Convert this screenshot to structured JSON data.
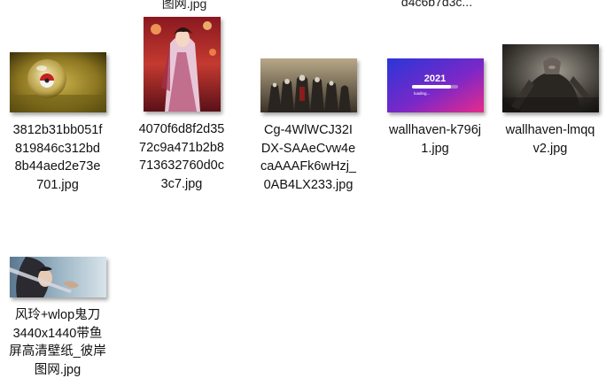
{
  "cutoff_labels": {
    "first": "图网.jpg",
    "second": "d4c6b7d3c..."
  },
  "files": [
    {
      "name_lines": [
        "3812b31bb051f",
        "819846c312bd",
        "8b44aed2e73e",
        "701.jpg"
      ],
      "thumb": "pokeball-thumbnail",
      "dims": [
        109,
        68
      ]
    },
    {
      "name_lines": [
        "4070f6d8f2d35",
        "72c9a471b2b8",
        "713632760d0c",
        "3c7.jpg"
      ],
      "thumb": "chinese-lady-art-thumbnail",
      "dims": [
        87,
        107
      ]
    },
    {
      "name_lines": [
        "Cg-4WlWCJ32I",
        "DX-SAAeCvw4e",
        "caAAAFk6wHzj_",
        "0AB4LX233.jpg"
      ],
      "thumb": "assassins-creed-group-thumbnail",
      "dims": [
        109,
        61
      ]
    },
    {
      "name_lines": [
        "wallhaven-k796j",
        "1.jpg"
      ],
      "thumb": "2021-loading-gradient-thumbnail",
      "dims": [
        109,
        61
      ]
    },
    {
      "name_lines": [
        "wallhaven-lmqq",
        "v2.jpg"
      ],
      "thumb": "dark-warrior-thumbnail",
      "dims": [
        109,
        77
      ]
    },
    {
      "name_lines": [
        "风玲+wlop鬼刀",
        "3440x1440带鱼",
        "屏高清壁纸_彼岸",
        "图网.jpg"
      ],
      "thumb": "wlop-ghostblade-thumbnail",
      "dims": [
        109,
        46
      ]
    }
  ],
  "thumb_text": {
    "year": "2021",
    "loading": "loading..."
  }
}
